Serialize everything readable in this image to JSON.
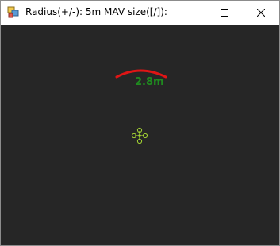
{
  "window": {
    "title": "Radius(+/-): 5m MAV size([/]): 0....",
    "app_icon": "window-app-icon",
    "minimize_icon": "minimize-icon",
    "maximize_icon": "maximize-icon",
    "close_icon": "close-icon"
  },
  "viewport": {
    "background": "#262626",
    "radius_arc_color": "#e01515",
    "radius_label": "2.8m",
    "radius_label_color": "#1f8a1f",
    "mav_color": "#a4d433",
    "mav_icon": "quadcopter-icon"
  }
}
